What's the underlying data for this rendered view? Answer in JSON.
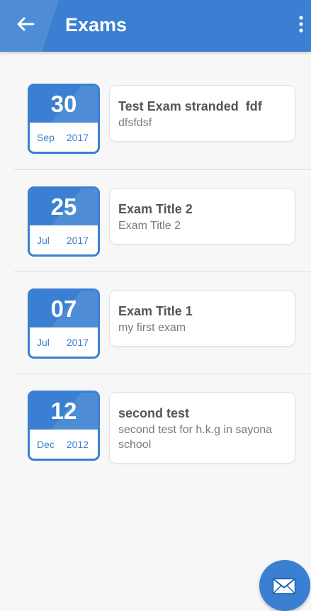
{
  "header": {
    "title": "Exams",
    "back_icon": "arrow-left-icon",
    "menu_icon": "more-vertical-icon"
  },
  "colors": {
    "primary": "#3a7fd1",
    "background": "#f7f7f7",
    "card": "#ffffff"
  },
  "exams": [
    {
      "day": "30",
      "month": "Sep",
      "year": "2017",
      "title": "Test Exam stranded  fdf",
      "description": "dfsfdsf"
    },
    {
      "day": "25",
      "month": "Jul",
      "year": "2017",
      "title": "Exam Title 2",
      "description": "Exam Title 2"
    },
    {
      "day": "07",
      "month": "Jul",
      "year": "2017",
      "title": "Exam Title 1",
      "description": "my first exam"
    },
    {
      "day": "12",
      "month": "Dec",
      "year": "2012",
      "title": "second test",
      "description": "second test for h.k.g in sayona school"
    }
  ],
  "fab": {
    "icon": "mail-icon"
  }
}
